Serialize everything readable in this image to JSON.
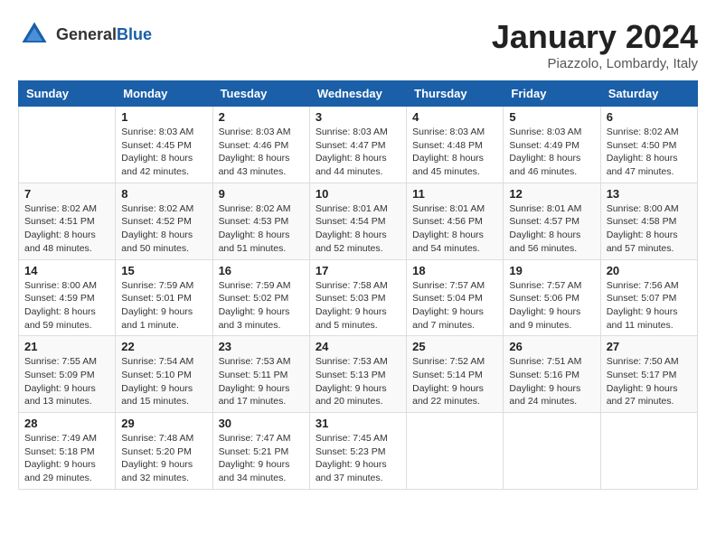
{
  "header": {
    "logo_general": "General",
    "logo_blue": "Blue",
    "month_title": "January 2024",
    "location": "Piazzolo, Lombardy, Italy"
  },
  "weekdays": [
    "Sunday",
    "Monday",
    "Tuesday",
    "Wednesday",
    "Thursday",
    "Friday",
    "Saturday"
  ],
  "weeks": [
    [
      {
        "num": "",
        "detail": ""
      },
      {
        "num": "1",
        "detail": "Sunrise: 8:03 AM\nSunset: 4:45 PM\nDaylight: 8 hours\nand 42 minutes."
      },
      {
        "num": "2",
        "detail": "Sunrise: 8:03 AM\nSunset: 4:46 PM\nDaylight: 8 hours\nand 43 minutes."
      },
      {
        "num": "3",
        "detail": "Sunrise: 8:03 AM\nSunset: 4:47 PM\nDaylight: 8 hours\nand 44 minutes."
      },
      {
        "num": "4",
        "detail": "Sunrise: 8:03 AM\nSunset: 4:48 PM\nDaylight: 8 hours\nand 45 minutes."
      },
      {
        "num": "5",
        "detail": "Sunrise: 8:03 AM\nSunset: 4:49 PM\nDaylight: 8 hours\nand 46 minutes."
      },
      {
        "num": "6",
        "detail": "Sunrise: 8:02 AM\nSunset: 4:50 PM\nDaylight: 8 hours\nand 47 minutes."
      }
    ],
    [
      {
        "num": "7",
        "detail": "Sunrise: 8:02 AM\nSunset: 4:51 PM\nDaylight: 8 hours\nand 48 minutes."
      },
      {
        "num": "8",
        "detail": "Sunrise: 8:02 AM\nSunset: 4:52 PM\nDaylight: 8 hours\nand 50 minutes."
      },
      {
        "num": "9",
        "detail": "Sunrise: 8:02 AM\nSunset: 4:53 PM\nDaylight: 8 hours\nand 51 minutes."
      },
      {
        "num": "10",
        "detail": "Sunrise: 8:01 AM\nSunset: 4:54 PM\nDaylight: 8 hours\nand 52 minutes."
      },
      {
        "num": "11",
        "detail": "Sunrise: 8:01 AM\nSunset: 4:56 PM\nDaylight: 8 hours\nand 54 minutes."
      },
      {
        "num": "12",
        "detail": "Sunrise: 8:01 AM\nSunset: 4:57 PM\nDaylight: 8 hours\nand 56 minutes."
      },
      {
        "num": "13",
        "detail": "Sunrise: 8:00 AM\nSunset: 4:58 PM\nDaylight: 8 hours\nand 57 minutes."
      }
    ],
    [
      {
        "num": "14",
        "detail": "Sunrise: 8:00 AM\nSunset: 4:59 PM\nDaylight: 8 hours\nand 59 minutes."
      },
      {
        "num": "15",
        "detail": "Sunrise: 7:59 AM\nSunset: 5:01 PM\nDaylight: 9 hours\nand 1 minute."
      },
      {
        "num": "16",
        "detail": "Sunrise: 7:59 AM\nSunset: 5:02 PM\nDaylight: 9 hours\nand 3 minutes."
      },
      {
        "num": "17",
        "detail": "Sunrise: 7:58 AM\nSunset: 5:03 PM\nDaylight: 9 hours\nand 5 minutes."
      },
      {
        "num": "18",
        "detail": "Sunrise: 7:57 AM\nSunset: 5:04 PM\nDaylight: 9 hours\nand 7 minutes."
      },
      {
        "num": "19",
        "detail": "Sunrise: 7:57 AM\nSunset: 5:06 PM\nDaylight: 9 hours\nand 9 minutes."
      },
      {
        "num": "20",
        "detail": "Sunrise: 7:56 AM\nSunset: 5:07 PM\nDaylight: 9 hours\nand 11 minutes."
      }
    ],
    [
      {
        "num": "21",
        "detail": "Sunrise: 7:55 AM\nSunset: 5:09 PM\nDaylight: 9 hours\nand 13 minutes."
      },
      {
        "num": "22",
        "detail": "Sunrise: 7:54 AM\nSunset: 5:10 PM\nDaylight: 9 hours\nand 15 minutes."
      },
      {
        "num": "23",
        "detail": "Sunrise: 7:53 AM\nSunset: 5:11 PM\nDaylight: 9 hours\nand 17 minutes."
      },
      {
        "num": "24",
        "detail": "Sunrise: 7:53 AM\nSunset: 5:13 PM\nDaylight: 9 hours\nand 20 minutes."
      },
      {
        "num": "25",
        "detail": "Sunrise: 7:52 AM\nSunset: 5:14 PM\nDaylight: 9 hours\nand 22 minutes."
      },
      {
        "num": "26",
        "detail": "Sunrise: 7:51 AM\nSunset: 5:16 PM\nDaylight: 9 hours\nand 24 minutes."
      },
      {
        "num": "27",
        "detail": "Sunrise: 7:50 AM\nSunset: 5:17 PM\nDaylight: 9 hours\nand 27 minutes."
      }
    ],
    [
      {
        "num": "28",
        "detail": "Sunrise: 7:49 AM\nSunset: 5:18 PM\nDaylight: 9 hours\nand 29 minutes."
      },
      {
        "num": "29",
        "detail": "Sunrise: 7:48 AM\nSunset: 5:20 PM\nDaylight: 9 hours\nand 32 minutes."
      },
      {
        "num": "30",
        "detail": "Sunrise: 7:47 AM\nSunset: 5:21 PM\nDaylight: 9 hours\nand 34 minutes."
      },
      {
        "num": "31",
        "detail": "Sunrise: 7:45 AM\nSunset: 5:23 PM\nDaylight: 9 hours\nand 37 minutes."
      },
      {
        "num": "",
        "detail": ""
      },
      {
        "num": "",
        "detail": ""
      },
      {
        "num": "",
        "detail": ""
      }
    ]
  ]
}
